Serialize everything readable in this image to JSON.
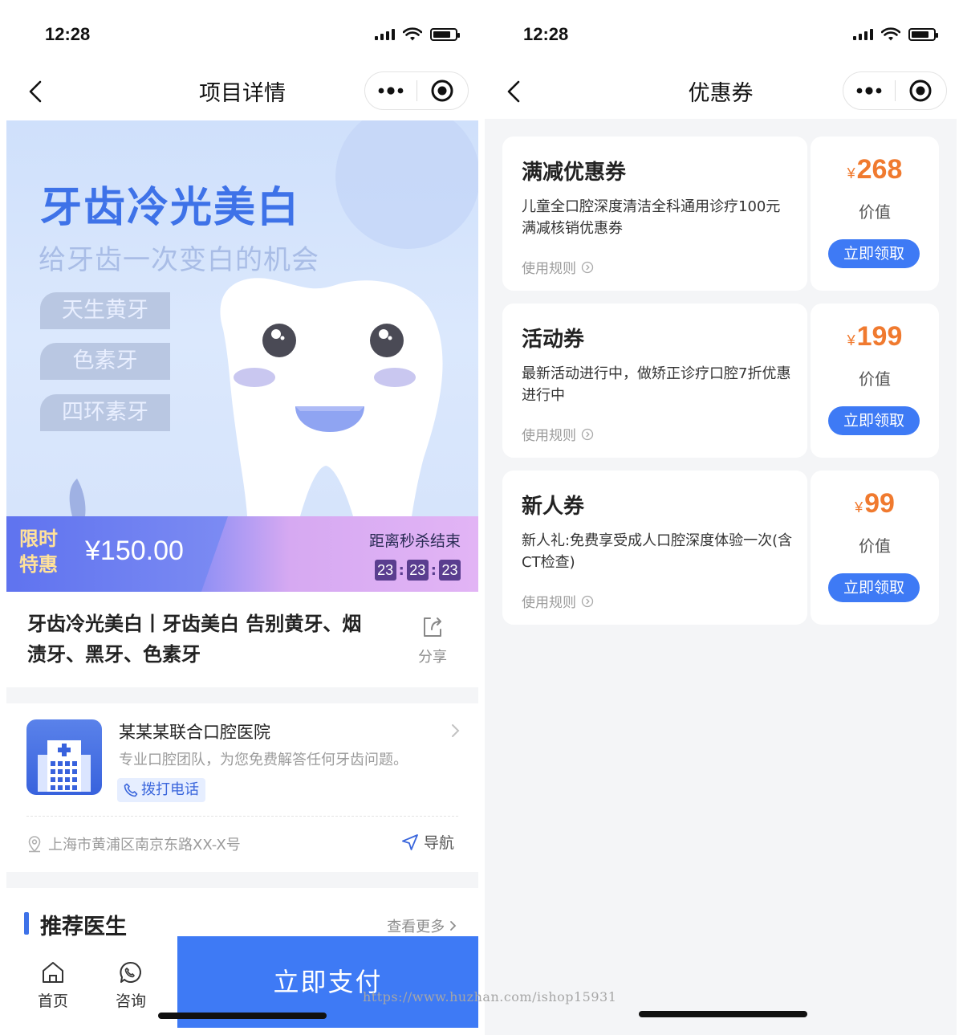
{
  "left": {
    "status": {
      "time": "12:28"
    },
    "nav": {
      "title": "项目详情"
    },
    "banner": {
      "title": "牙齿冷光美白",
      "subtitle": "给牙齿一次变白的机会",
      "tags": [
        "天生黄牙",
        "色素牙",
        "四环素牙"
      ]
    },
    "promo": {
      "tag_line1": "限时",
      "tag_line2": "特惠",
      "price": "¥150.00",
      "countdown_label": "距离秒杀结束",
      "countdown": [
        "23",
        "23",
        "23"
      ]
    },
    "product": {
      "title": "牙齿冷光美白丨牙齿美白 告别黄牙、烟渍牙、黑牙、色素牙",
      "share_label": "分享"
    },
    "hospital": {
      "name": "某某某联合口腔医院",
      "desc": "专业口腔团队，为您免费解答任何牙齿问题。",
      "call_label": "拨打电话",
      "address": "上海市黄浦区南京东路XX-X号",
      "navigate_label": "导航"
    },
    "section": {
      "title": "推荐医生",
      "more_label": "查看更多"
    },
    "tabbar": {
      "home_label": "首页",
      "consult_label": "咨询",
      "pay_label": "立即支付"
    }
  },
  "right": {
    "status": {
      "time": "12:28"
    },
    "nav": {
      "title": "优惠券"
    },
    "coupons": [
      {
        "title": "满减优惠券",
        "desc": "儿童全口腔深度清洁全科通用诊疗100元满减核销优惠券",
        "rule_label": "使用规则",
        "currency": "¥",
        "amount": "268",
        "value_label": "价值",
        "button_label": "立即领取"
      },
      {
        "title": "活动券",
        "desc": "最新活动进行中，做矫正诊疗口腔7折优惠进行中",
        "rule_label": "使用规则",
        "currency": "¥",
        "amount": "199",
        "value_label": "价值",
        "button_label": "立即领取"
      },
      {
        "title": "新人券",
        "desc": "新人礼:免费享受成人口腔深度体验一次(含CT检查)",
        "rule_label": "使用规则",
        "currency": "¥",
        "amount": "99",
        "value_label": "价值",
        "button_label": "立即领取"
      }
    ]
  },
  "watermark": "https://www.huzhan.com/ishop15931",
  "colors": {
    "primary": "#3e7af5",
    "price_orange": "#f07a2f",
    "banner_blue": "#3e72e8"
  },
  "icons": [
    "back-icon",
    "more-icon",
    "target-icon",
    "share-icon",
    "chevron-right-icon",
    "phone-icon",
    "location-icon",
    "navigate-icon",
    "home-icon",
    "consult-icon",
    "info-circle-icon"
  ]
}
